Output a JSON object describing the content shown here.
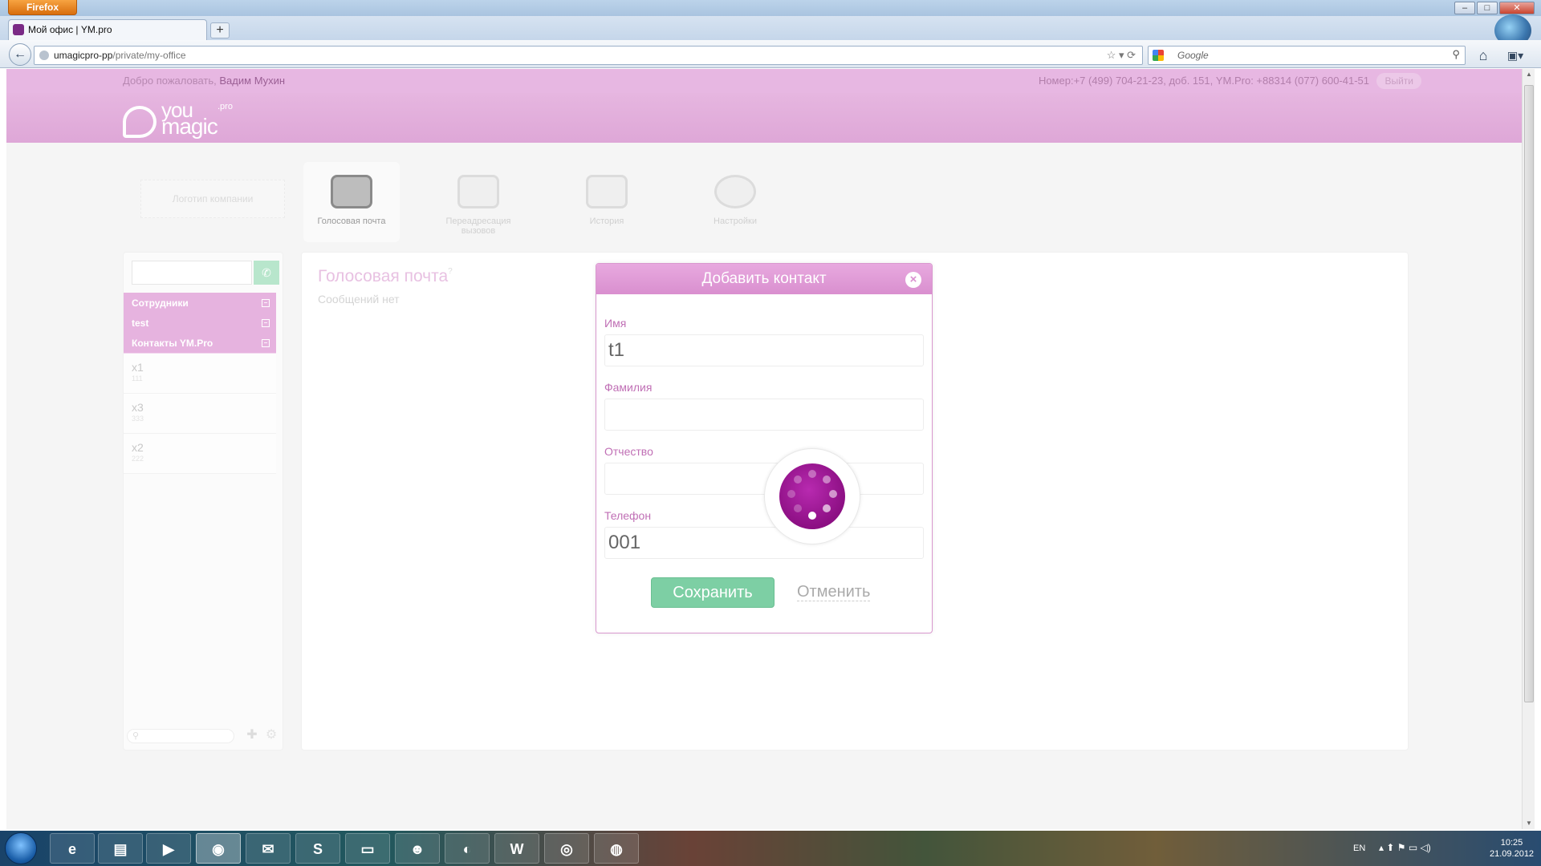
{
  "browser": {
    "menu_label": "Firefox",
    "tab_title": "Мой офис | YM.pro",
    "url_host": "umagicpro-pp",
    "url_path": "/private/my-office",
    "search_placeholder": "Google",
    "window_controls": [
      "–",
      "□",
      "✕"
    ]
  },
  "site": {
    "welcome_prefix": "Добро пожаловать,",
    "user_name": "Вадим Мухин",
    "phone_info": "Номер:+7 (499) 704-21-23, доб. 151, YM.Pro: +88314 (077) 600-41-51",
    "logout": "Выйти",
    "logo": {
      "you": "YOU",
      "magic": "magic",
      "pro": ".pro"
    },
    "company_logo_placeholder": "Логотип компании",
    "nav": [
      {
        "label": "Голосовая почта",
        "icon": "voicemail-icon",
        "active": true
      },
      {
        "label": "Переадресация вызовов",
        "icon": "call-forward-icon",
        "active": false
      },
      {
        "label": "История",
        "icon": "history-icon",
        "active": false
      },
      {
        "label": "Настройки",
        "icon": "settings-icon",
        "active": false
      }
    ],
    "accent_color": "#e6b3df",
    "green_color": "#7dcfa4"
  },
  "sidebar": {
    "groups": [
      "Сотрудники",
      "test",
      "Контакты YM.Pro"
    ],
    "contacts": [
      {
        "name": "x1",
        "phone": "111"
      },
      {
        "name": "x3",
        "phone": "333"
      },
      {
        "name": "x2",
        "phone": "222"
      }
    ]
  },
  "main": {
    "title": "Голосовая почта",
    "help": "?",
    "empty_text": "Сообщений нет"
  },
  "modal": {
    "title": "Добавить контакт",
    "fields": [
      {
        "label": "Имя",
        "value": "t1"
      },
      {
        "label": "Фамилия",
        "value": ""
      },
      {
        "label": "Отчество",
        "value": ""
      },
      {
        "label": "Телефон",
        "value": "001"
      }
    ],
    "save_label": "Сохранить",
    "cancel_label": "Отменить",
    "loading": true
  },
  "taskbar": {
    "apps": [
      "IE",
      "Explorer",
      "Media",
      "Firefox",
      "Mail",
      "Skype",
      "Console",
      "Alien",
      "Finder",
      "Word",
      "OS",
      "Eclipse"
    ],
    "active_app": "Firefox",
    "language": "EN",
    "time": "10:25",
    "date": "21.09.2012"
  }
}
